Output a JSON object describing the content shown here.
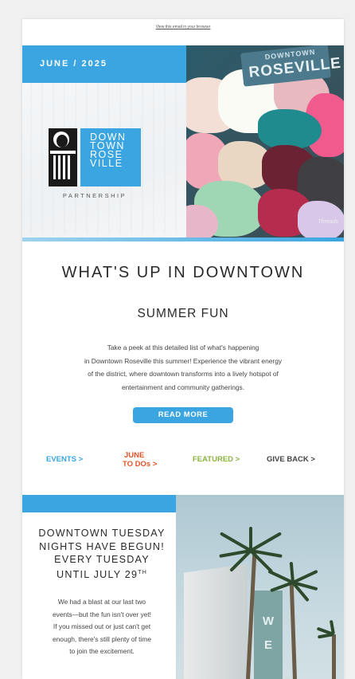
{
  "header": {
    "view_in_browser": "View this email in your browser"
  },
  "hero": {
    "date": "JUNE / 2025",
    "logo_lines": [
      "DOWN",
      "TOWN",
      "ROSE",
      "VILLE"
    ],
    "logo_sub": "PARTNERSHIP",
    "sign_top": "DOWNTOWN",
    "sign_main": "ROSEVILLE",
    "photo_credit": "Threads",
    "image_icon": "photo-icon"
  },
  "main": {
    "headline": "WHAT'S UP IN DOWNTOWN",
    "subhead": "SUMMER FUN",
    "intro_lines": [
      "Take a peek at this detailed list of what's happening",
      "in Downtown Roseville this summer! Experience the vibrant energy",
      "of the district, where downtown transforms into a lively hotspot of",
      "entertainment and community gatherings."
    ],
    "read_more": "READ MORE"
  },
  "nav": {
    "events": "EVENTS >",
    "june_line1": "JUNE",
    "june_line2": "TO DOs >",
    "featured": "FEATURED >",
    "give_back": "GIVE BACK >"
  },
  "feature": {
    "title_lines": [
      "DOWNTOWN TUESDAY",
      "NIGHTS HAVE BEGUN!",
      "EVERY TUESDAY",
      "UNTIL JULY 29"
    ],
    "title_sup": "TH",
    "body_lines": [
      "We had a blast at our last two",
      "events—but the fun isn't over yet!",
      "If you missed out or just can't get",
      "enough, there's still plenty of time",
      "to join the excitement."
    ],
    "building_letters": [
      "W",
      "E"
    ]
  },
  "colors": {
    "accent_blue": "#3aa5e0",
    "june_orange": "#e35328",
    "featured_green": "#8cb33f",
    "give_back_gray": "#444444"
  }
}
